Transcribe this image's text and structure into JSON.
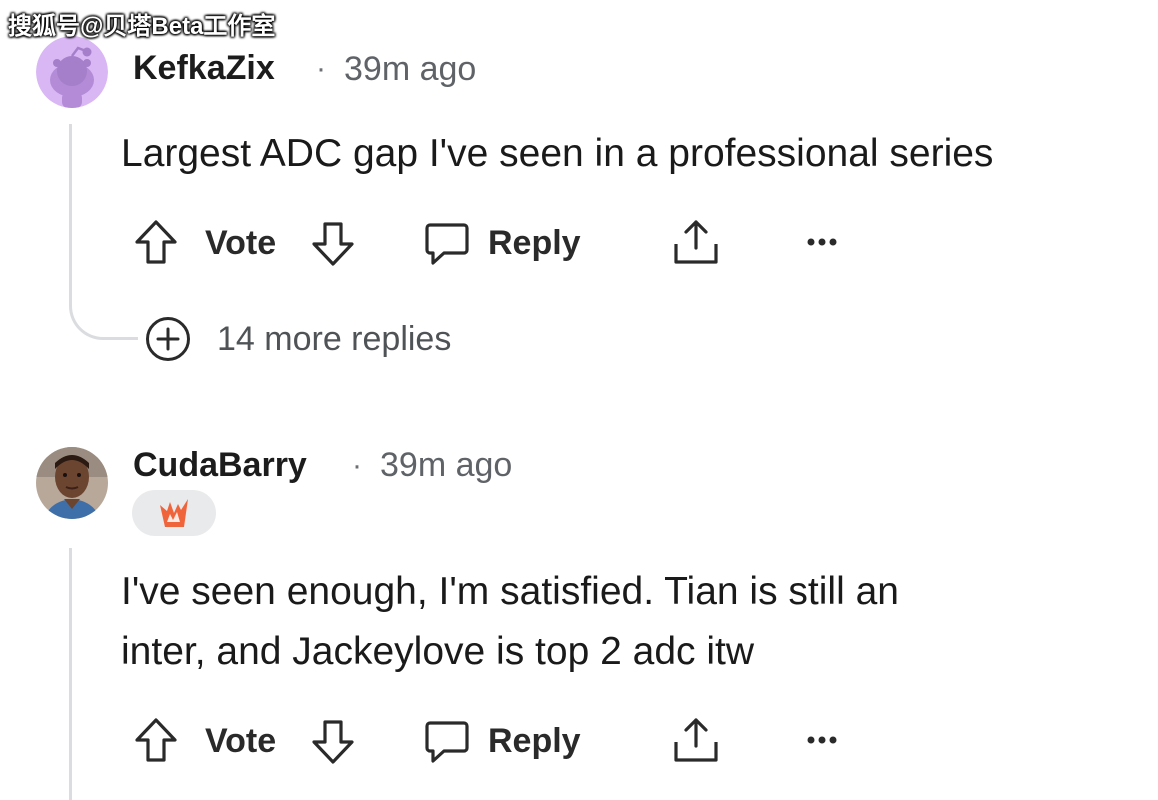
{
  "watermark": {
    "text": "搜狐号@贝塔Beta工作室"
  },
  "comments": [
    {
      "username": "KefkaZix",
      "separator": "·",
      "time": "39m ago",
      "text": "Largest ADC gap I've seen in a professional series",
      "actions": {
        "vote_label": "Vote",
        "reply_label": "Reply"
      },
      "more_replies": "14 more replies",
      "avatar_color": "#d9b7f5"
    },
    {
      "username": "CudaBarry",
      "separator": "·",
      "time": "39m ago",
      "text_lines": [
        "I've seen enough, I'm satisfied. Tian is still an",
        "inter, and Jackeylove is top 2 adc itw"
      ],
      "actions": {
        "vote_label": "Vote",
        "reply_label": "Reply"
      },
      "flair_color": "#f0643c"
    }
  ],
  "icons": {
    "upvote": "arrow-up-icon",
    "downvote": "arrow-down-icon",
    "reply": "speech-bubble-icon",
    "share": "share-icon",
    "more": "more-options-icon",
    "expand": "plus-circle-icon"
  }
}
